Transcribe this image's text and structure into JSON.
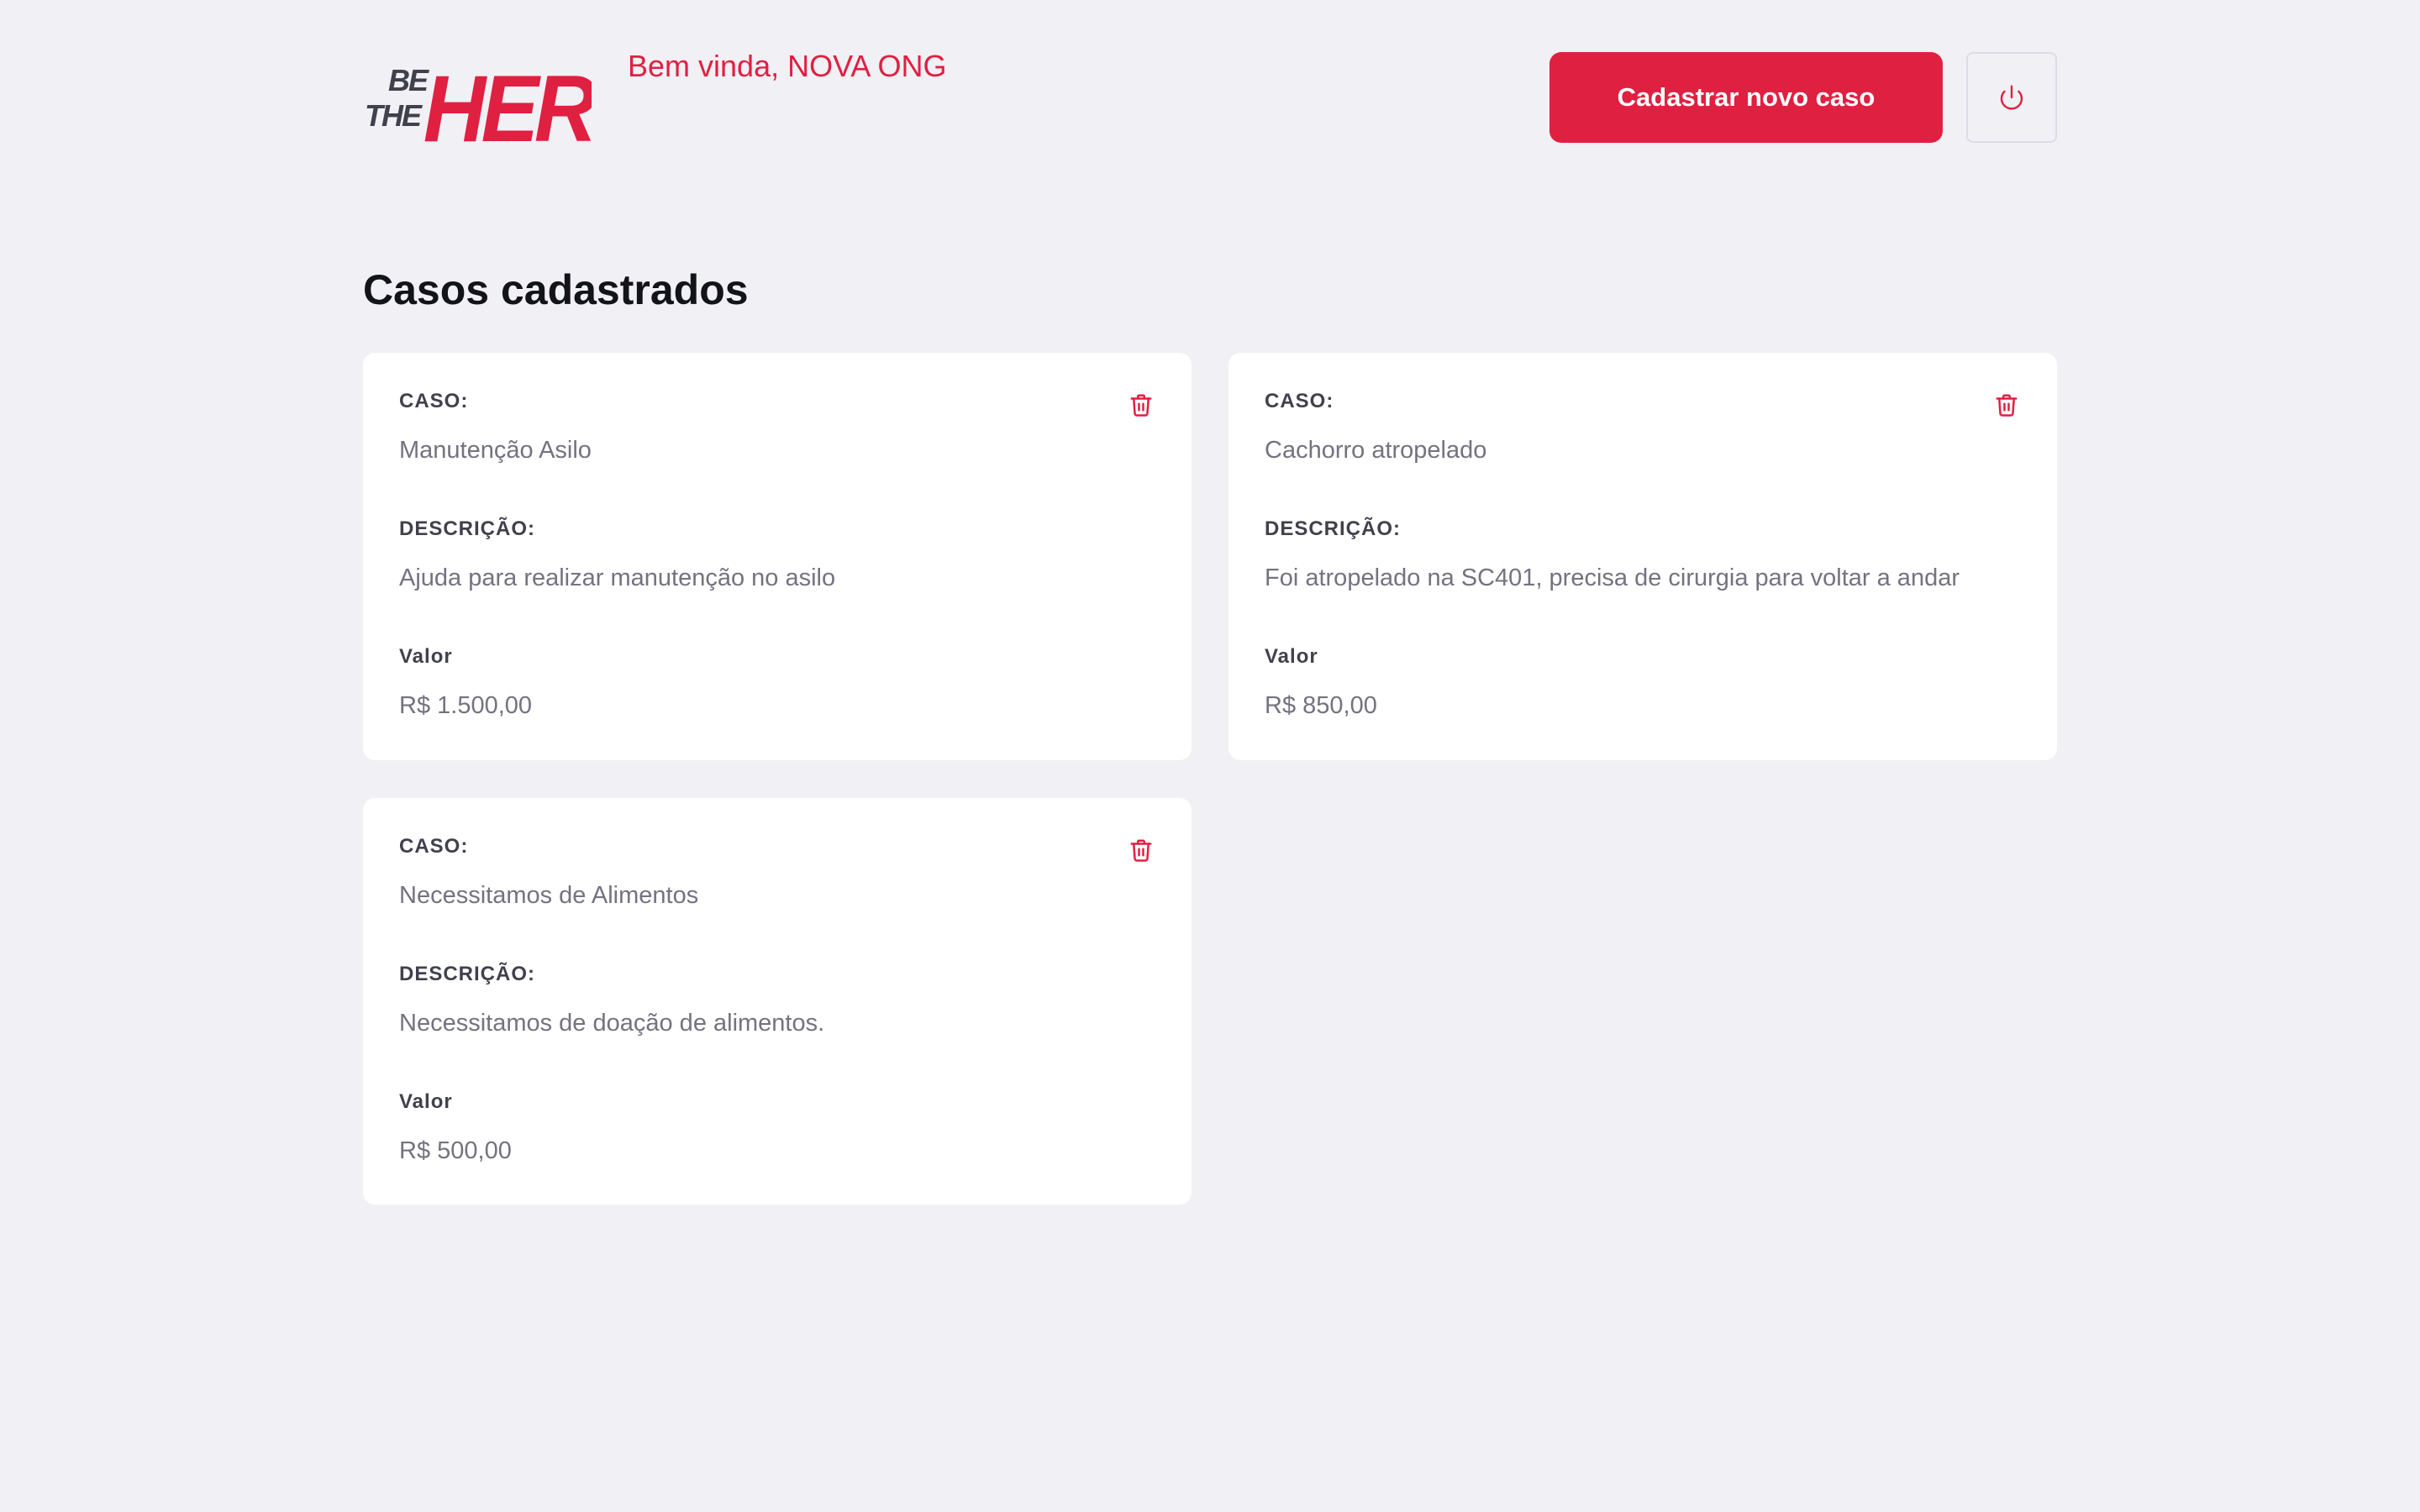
{
  "header": {
    "logo_alt": "Be The Hero",
    "welcome_prefix": "Bem vinda, ",
    "ngo_name": "NOVA ONG",
    "new_case_label": "Cadastrar novo caso",
    "logout_icon": "power-icon"
  },
  "main": {
    "title": "Casos cadastrados",
    "case_label": "CASO:",
    "description_label": "DESCRIÇÃO:",
    "value_label": "Valor",
    "delete_icon": "trash-icon",
    "cases": [
      {
        "title": "Manutenção Asilo",
        "description": "Ajuda para realizar manutenção no asilo",
        "value": "R$ 1.500,00"
      },
      {
        "title": "Cachorro atropelado",
        "description": "Foi atropelado na SC401, precisa de cirurgia para voltar a andar",
        "value": "R$ 850,00"
      },
      {
        "title": "Necessitamos de Alimentos",
        "description": "Necessitamos de doação de alimentos.",
        "value": "R$ 500,00"
      }
    ]
  },
  "colors": {
    "brand": "#E02041",
    "background": "#F0F0F5",
    "card": "#FFFFFF",
    "label": "#41414D",
    "text": "#737380",
    "title": "#13131A"
  }
}
